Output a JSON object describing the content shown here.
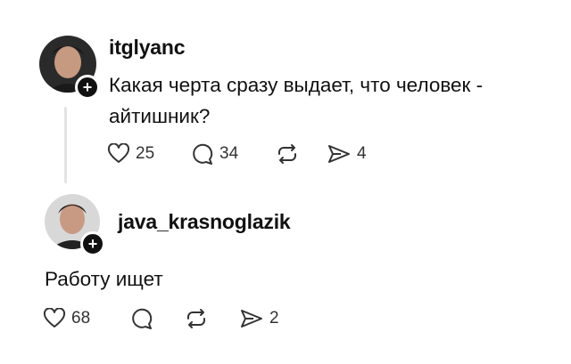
{
  "post": {
    "username": "itglyanc",
    "text_line1": "Какая черта сразу выдает, что человек -",
    "text_line2": "айтишник?",
    "likes": "25",
    "comments": "34",
    "shares": "4"
  },
  "reply": {
    "username": "java_krasnoglazik",
    "text": "Работу ищет",
    "likes": "68",
    "shares": "2"
  },
  "icons": [
    "heart-icon",
    "comment-icon",
    "repost-icon",
    "share-icon",
    "plus-icon"
  ]
}
